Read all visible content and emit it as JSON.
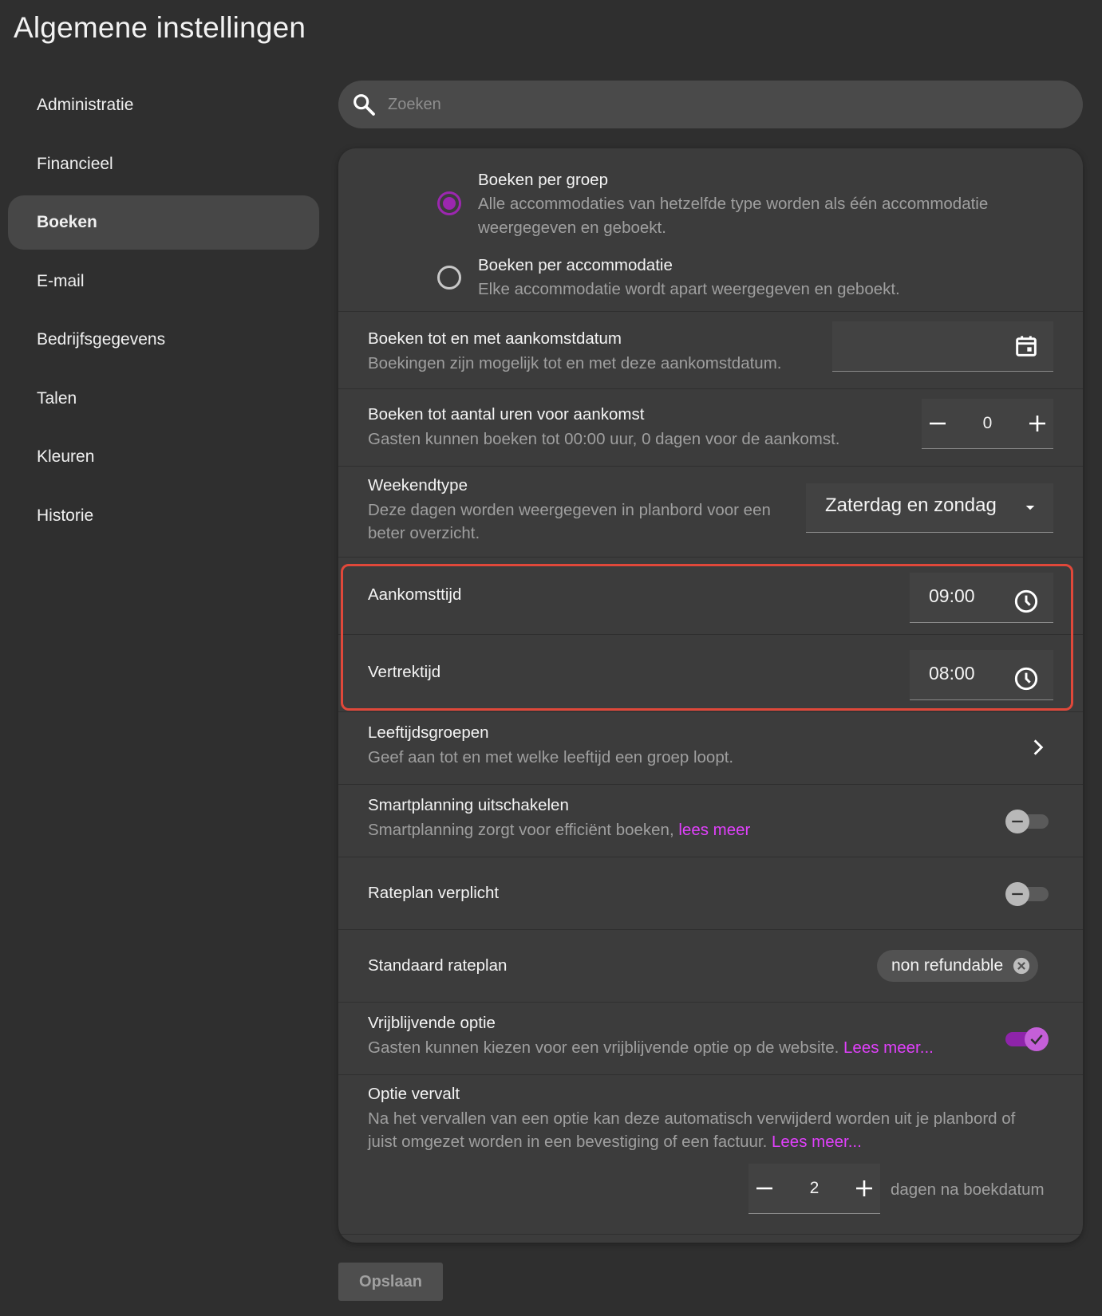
{
  "page": {
    "title": "Algemene instellingen"
  },
  "sidebar": {
    "items": [
      {
        "label": "Administratie"
      },
      {
        "label": "Financieel"
      },
      {
        "label": "Boeken",
        "active": true
      },
      {
        "label": "E-mail"
      },
      {
        "label": "Bedrijfsgegevens"
      },
      {
        "label": "Talen"
      },
      {
        "label": "Kleuren"
      },
      {
        "label": "Historie"
      }
    ]
  },
  "search": {
    "placeholder": "Zoeken",
    "icon": "search-icon"
  },
  "booking_mode": {
    "options": [
      {
        "title": "Boeken per groep",
        "desc": "Alle accommodaties van hetzelfde type worden als één accommodatie weergegeven en geboekt.",
        "selected": true
      },
      {
        "title": "Boeken per accommodatie",
        "desc": "Elke accommodatie wordt apart weergegeven en geboekt.",
        "selected": false
      }
    ]
  },
  "book_until_arrival_date": {
    "title": "Boeken tot en met aankomstdatum",
    "desc": "Boekingen zijn mogelijk tot en met deze aankomstdatum.",
    "value": "",
    "icon": "calendar-icon"
  },
  "book_hours_before": {
    "title": "Boeken tot aantal uren voor aankomst",
    "desc": "Gasten kunnen boeken tot 00:00 uur, 0 dagen voor de aankomst.",
    "value": "0"
  },
  "weekend_type": {
    "title": "Weekendtype",
    "desc": "Deze dagen worden weergegeven in planbord voor een beter overzicht.",
    "value": "Zaterdag en zondag"
  },
  "arrival_time": {
    "title": "Aankomsttijd",
    "value": "09:00",
    "icon": "clock-icon"
  },
  "departure_time": {
    "title": "Vertrektijd",
    "value": "08:00",
    "icon": "clock-icon"
  },
  "age_groups": {
    "title": "Leeftijdsgroepen",
    "desc": "Geef aan tot en met welke leeftijd een groep loopt."
  },
  "smartplanning": {
    "title": "Smartplanning uitschakelen",
    "desc": "Smartplanning zorgt voor efficiënt boeken,",
    "link": "lees meer",
    "on": false
  },
  "rateplan_required": {
    "title": "Rateplan verplicht",
    "on": false
  },
  "default_rateplan": {
    "title": "Standaard rateplan",
    "chip": "non refundable"
  },
  "optional_option": {
    "title": "Vrijblijvende optie",
    "desc": "Gasten kunnen kiezen voor een vrijblijvende optie op de website.",
    "link": "Lees meer...",
    "on": true
  },
  "option_expires": {
    "title": "Optie vervalt",
    "desc": "Na het vervallen van een optie kan deze automatisch verwijderd worden uit je planbord of juist omgezet worden in een bevestiging of een factuur.",
    "link": "Lees meer...",
    "value": "2",
    "suffix": "dagen na boekdatum"
  },
  "actions": {
    "save_label": "Opslaan"
  },
  "colors": {
    "accent": "#9c27b0",
    "link": "#e040fb",
    "highlight": "#e0483a"
  }
}
